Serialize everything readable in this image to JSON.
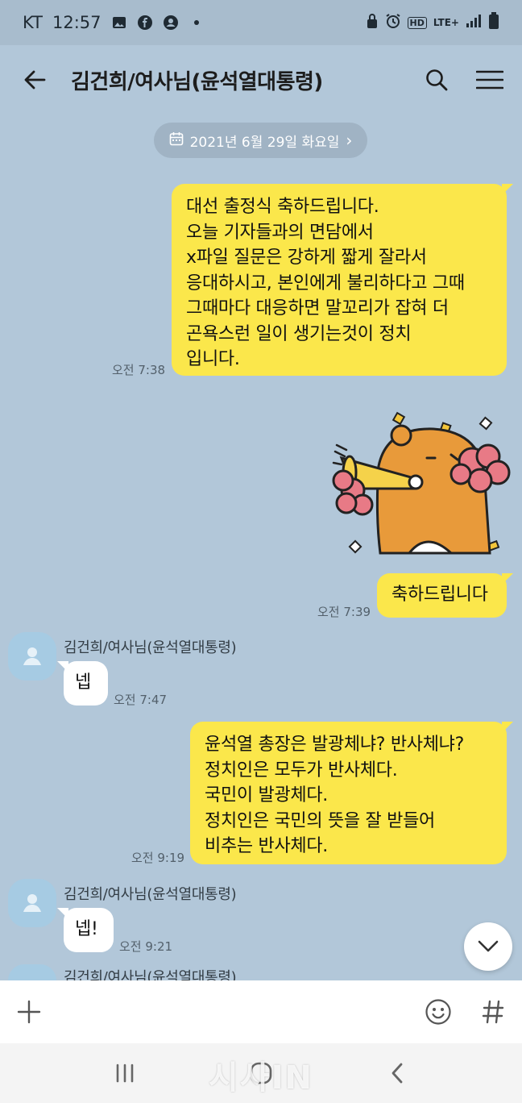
{
  "status_bar": {
    "carrier": "KT",
    "time": "12:57",
    "left_icons": [
      "image-icon",
      "facebook-icon",
      "account-icon",
      "dot-icon"
    ],
    "right_icons": [
      "lock-icon",
      "alarm-icon",
      "hd-icon",
      "lte-icon",
      "signal-icon",
      "battery-icon"
    ],
    "hd_label": "HD",
    "lte_label": "LTE+"
  },
  "header": {
    "title": "김건희/여사님(윤석열대통령)",
    "icons": [
      "back-arrow-icon",
      "search-icon",
      "menu-icon"
    ]
  },
  "date_divider": {
    "label": "2021년 6월 29일 화요일",
    "icon": "calendar-icon",
    "chevron": "›"
  },
  "messages": [
    {
      "from": "me",
      "lines": [
        "대선 출정식 축하드립니다.",
        "오늘 기자들과의 면담에서",
        "x파일 질문은 강하게 짧게 잘라서",
        "응대하시고, 본인에게 불리하다고 그때",
        "그때마다 대응하면 말꼬리가 잡혀 더",
        "곤욕스런 일이 생기는것이 정치",
        "입니다."
      ],
      "time": "오전 7:38"
    },
    {
      "from": "me",
      "type": "sticker",
      "sticker": "cheering-lion-sticker"
    },
    {
      "from": "me",
      "lines": [
        "축하드립니다"
      ],
      "time": "오전 7:39"
    },
    {
      "from": "other",
      "sender": "김건희/여사님(윤석열대통령)",
      "lines": [
        "넵"
      ],
      "time": "오전 7:47"
    },
    {
      "from": "me",
      "lines": [
        "윤석열 총장은 발광체냐? 반사체냐?",
        "정치인은 모두가 반사체다.",
        "국민이 발광체다.",
        "정치인은 국민의 뜻을 잘 받들어",
        "비추는 반사체다."
      ],
      "time": "오전 9:19"
    },
    {
      "from": "other",
      "sender": "김건희/여사님(윤석열대통령)",
      "lines": [
        "넵!"
      ],
      "time": "오전 9:21"
    },
    {
      "from": "other",
      "sender": "김건희/여사님(윤석열대통령)",
      "partial": true
    }
  ],
  "input_bar": {
    "value": "",
    "icons": [
      "plus-icon",
      "emoji-icon",
      "hash-icon"
    ]
  },
  "scroll_down_icon": "chevron-down-icon",
  "nav_bar": {
    "icons": [
      "recents-icon",
      "home-icon",
      "back-icon"
    ]
  },
  "watermark": "시사IN"
}
